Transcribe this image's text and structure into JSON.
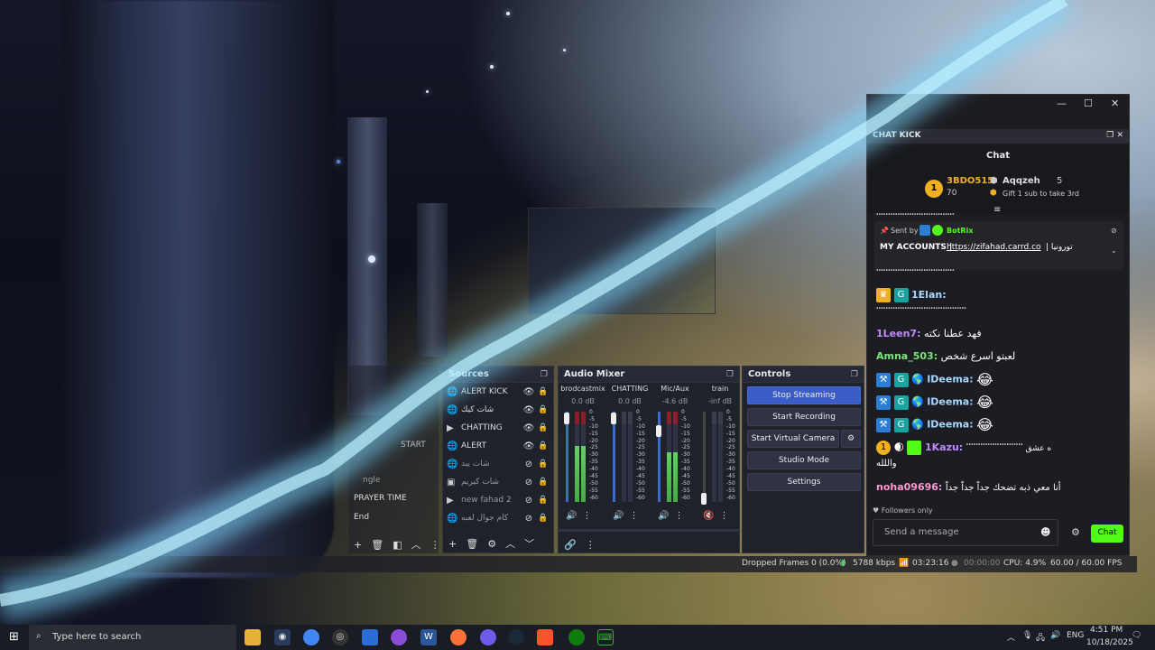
{
  "colors": {
    "kick_green": "#53fc18",
    "obs_blue": "#3c5cc6",
    "neon": "#7fd8ff"
  },
  "obs": {
    "scenes_partial": [
      "PRAYER TIME",
      "End",
      "START",
      "ngle"
    ],
    "sources": {
      "title": "Sources",
      "items": [
        {
          "icon": "globe-icon",
          "label": "ALERT KICK",
          "visible": true
        },
        {
          "icon": "globe-icon",
          "label": "شات كيك",
          "visible": true
        },
        {
          "icon": "play-icon",
          "label": "CHATTING",
          "visible": true
        },
        {
          "icon": "globe-icon",
          "label": "ALERT",
          "visible": true
        },
        {
          "icon": "globe-icon",
          "label": "شات يبد",
          "visible": false
        },
        {
          "icon": "image-icon",
          "label": "شات كيريم",
          "visible": false
        },
        {
          "icon": "play-icon",
          "label": "new fahad 2",
          "visible": false
        },
        {
          "icon": "globe-icon",
          "label": "كام جوال لعبه",
          "visible": false
        }
      ]
    },
    "mixer": {
      "title": "Audio Mixer",
      "channels": [
        {
          "name": "brodcastmix",
          "db": "0.0 dB",
          "level": 0.62
        },
        {
          "name": "CHATTING",
          "db": "0.0 dB",
          "level": 0.0
        },
        {
          "name": "Mic/Aux",
          "db": "-4.6 dB",
          "level": 0.55
        },
        {
          "name": "train",
          "db": "-inf dB",
          "level": 0.0
        }
      ],
      "scale": [
        "0",
        "-5",
        "-10",
        "-15",
        "-20",
        "-25",
        "-30",
        "-35",
        "-40",
        "-45",
        "-50",
        "-55",
        "-60"
      ]
    },
    "controls": {
      "title": "Controls",
      "stop_streaming": "Stop Streaming",
      "start_recording": "Start Recording",
      "start_virtual_camera": "Start Virtual Camera",
      "studio_mode": "Studio Mode",
      "settings": "Settings"
    },
    "status": {
      "dropped_frames": "Dropped Frames 0 (0.0%)",
      "bitrate": "5788 kbps",
      "stream_time": "03:23:16",
      "record_time": "00:00:00",
      "cpu": "CPU: 4.9%",
      "fps": "60.00 / 60.00 FPS"
    }
  },
  "chat": {
    "dock_title": "CHAT KICK",
    "header": "Chat",
    "leaderboard": {
      "first_name": "3BDO515",
      "first_count": "70",
      "second_name": "Aqqzeh",
      "second_count": "5",
      "gift_text": "Gift 1 sub to take 3rd"
    },
    "pinned": {
      "sent_by_label": "Sent by",
      "bot_name": "BotRix",
      "text_prefix": "MY ACCOUNTS |",
      "link": "https://zifahad.carrd.co",
      "text_suffix": "| تورونيا"
    },
    "messages": [
      {
        "user": "",
        "text": "ٴٴٴٴٴٴٴٴٴٴٴٴٴٴٴٴٴٴٴٴٴٴٴٴٴٴٴٴٴٴٴٴٴ",
        "color": "#ffffff"
      },
      {
        "user": "1Elan:",
        "text": "",
        "color": "#a8d8ff"
      },
      {
        "user": "",
        "text": "ٴٴٴٴٴٴٴٴٴٴٴٴٴٴٴٴٴٴٴٴٴٴٴٴٴٴٴٴٴٴٴٴٴٴٴٴٴٴ",
        "color": "#ffffff"
      },
      {
        "user": "1Leen7:",
        "text": "فهد عطنا نكته",
        "color": "#c08aff"
      },
      {
        "user": "Amna_503:",
        "text": "لعبتو اسرع شخص",
        "color": "#7de37d"
      },
      {
        "user": "IDeema:",
        "text": "😂",
        "color": "#a8d8ff"
      },
      {
        "user": "IDeema:",
        "text": "😂",
        "color": "#a8d8ff"
      },
      {
        "user": "IDeema:",
        "text": "😂",
        "color": "#a8d8ff"
      },
      {
        "user": "1Kazu:",
        "text": "ه عشق ٴٴٴٴٴٴٴٴٴٴٴٴٴٴٴٴٴٴٴٴٴٴٴٴ",
        "color": "#c08aff"
      },
      {
        "user": "",
        "text": "واللله",
        "color": "#ffffff"
      },
      {
        "user": "noha09696:",
        "text": "أنا معي ذبه تضحك جداً جداً جداً",
        "color": "#ff9ad0"
      }
    ],
    "followers_only": "Followers only",
    "input_placeholder": "Send a message",
    "send_label": "Chat"
  },
  "taskbar": {
    "search_placeholder": "Type here to search",
    "lang": "ENG",
    "time": "4:51 PM",
    "date": "10/18/2025"
  }
}
